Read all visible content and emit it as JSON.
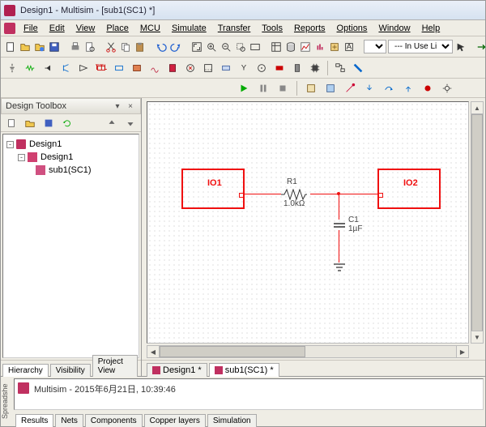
{
  "title": "Design1 - Multisim - [sub1(SC1) *]",
  "menu": [
    "File",
    "Edit",
    "View",
    "Place",
    "MCU",
    "Simulate",
    "Transfer",
    "Tools",
    "Reports",
    "Options",
    "Window",
    "Help"
  ],
  "toolbar1": {
    "dropdown": "--- In Use List ---",
    "zoom": ""
  },
  "design_toolbox": {
    "title": "Design Toolbox",
    "tree_root": "Design1",
    "tree_child": "Design1",
    "tree_leaf": "sub1(SC1)",
    "tabs": [
      "Hierarchy",
      "Visibility",
      "Project View"
    ]
  },
  "canvas": {
    "io1": "IO1",
    "io2": "IO2",
    "r_name": "R1",
    "r_val": "1.0kΩ",
    "c_name": "C1",
    "c_val": "1µF"
  },
  "editor_tabs": [
    "Design1 *",
    "sub1(SC1) *"
  ],
  "spreadsheet": {
    "label": "Spreadshe",
    "message": "Multisim  -  2015年6月21日, 10:39:46",
    "tabs": [
      "Results",
      "Nets",
      "Components",
      "Copper layers",
      "Simulation"
    ]
  }
}
